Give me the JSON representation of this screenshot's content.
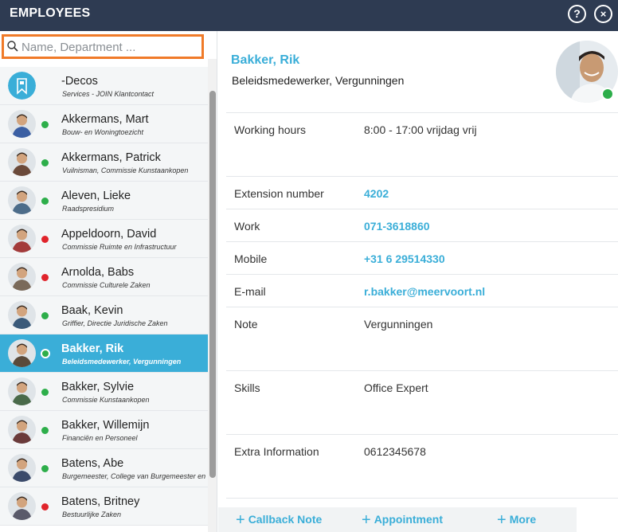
{
  "header": {
    "title": "EMPLOYEES",
    "help_label": "?",
    "close_label": "×"
  },
  "search": {
    "placeholder": "Name, Department ..."
  },
  "employees": [
    {
      "name": "-Decos",
      "subtitle": "Services - JOIN Klantcontact",
      "status": "none"
    },
    {
      "name": "Akkermans, Mart",
      "subtitle": "Bouw- en Woningtoezicht",
      "status": "green"
    },
    {
      "name": "Akkermans, Patrick",
      "subtitle": "Vuilnisman, Commissie Kunstaankopen",
      "status": "green"
    },
    {
      "name": "Aleven, Lieke",
      "subtitle": "Raadspresidium",
      "status": "green"
    },
    {
      "name": "Appeldoorn, David",
      "subtitle": "Commissie Ruimte en Infrastructuur",
      "status": "red"
    },
    {
      "name": "Arnolda, Babs",
      "subtitle": "Commissie Culturele Zaken",
      "status": "red"
    },
    {
      "name": "Baak, Kevin",
      "subtitle": "Griffier, Directie Juridische Zaken",
      "status": "green"
    },
    {
      "name": "Bakker, Rik",
      "subtitle": "Beleidsmedewerker, Vergunningen",
      "status": "green",
      "selected": true
    },
    {
      "name": "Bakker, Sylvie",
      "subtitle": "Commissie Kunstaankopen",
      "status": "green"
    },
    {
      "name": "Bakker, Willemijn",
      "subtitle": "Financiën en Personeel",
      "status": "green"
    },
    {
      "name": "Batens, Abe",
      "subtitle": "Burgemeester, College van Burgemeester en Wethouders",
      "status": "green"
    },
    {
      "name": "Batens, Britney",
      "subtitle": "Bestuurlijke Zaken",
      "status": "red"
    }
  ],
  "profile": {
    "name": "Bakker, Rik",
    "title": "Beleidsmedewerker, Vergunningen",
    "status_color": "#2dae4a",
    "details": [
      {
        "label": "Working hours",
        "value": "8:00 - 17:00 vrijdag vrij",
        "link": false
      },
      {
        "label": "Extension number",
        "value": "4202",
        "link": true
      },
      {
        "label": "Work",
        "value": "071-3618860",
        "link": true
      },
      {
        "label": "Mobile",
        "value": "+31 6 29514330",
        "link": true
      },
      {
        "label": "E-mail",
        "value": "r.bakker@meervoort.nl",
        "link": true
      },
      {
        "label": "Note",
        "value": "Vergunningen",
        "link": false
      },
      {
        "label": "Skills",
        "value": "Office Expert",
        "link": false
      },
      {
        "label": "Extra Information",
        "value": "0612345678",
        "link": false
      }
    ]
  },
  "footer": {
    "callback_label": "Callback Note",
    "appointment_label": "Appointment",
    "more_label": "More"
  },
  "colors": {
    "header": "#2e3b52",
    "accent": "#3aaed8",
    "search_border": "#f07a28",
    "online": "#2dae4a",
    "offline": "#e0242b"
  }
}
